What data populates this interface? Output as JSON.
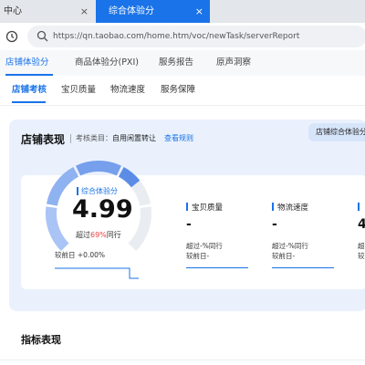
{
  "browser": {
    "tabs": [
      {
        "title": "中心",
        "close": "×"
      },
      {
        "title": "综合体验分",
        "close": "×"
      }
    ],
    "url": "https://qn.taobao.com/home.htm/voc/newTask/serverReport"
  },
  "top_tabs": [
    "店铺体验分",
    "商品体验分(PXI)",
    "服务报告",
    "原声洞察"
  ],
  "sub_tabs": [
    "店铺考核",
    "宝贝质量",
    "物流速度",
    "服务保障"
  ],
  "section": {
    "title": "店铺表现",
    "category_label": "考核类目：",
    "category_value": "自用闲置转让",
    "rule_link": "查看规则",
    "corner_label": "店铺综合体验分"
  },
  "gauge": {
    "label": "综合体验分",
    "value": "4.99",
    "beat_prefix": "超过",
    "beat_percent": "69%",
    "beat_suffix": "同行",
    "fraction": 0.69,
    "prev": "较前日 +0.00%"
  },
  "metrics": [
    {
      "name": "宝贝质量",
      "value": "-",
      "exceed": "超过-%同行",
      "prev": "较前日-"
    },
    {
      "name": "物流速度",
      "value": "-",
      "exceed": "超过-%同行",
      "prev": "较前日-"
    },
    {
      "name": "",
      "value": "4",
      "exceed": "超",
      "prev": "较"
    }
  ],
  "section2_title": "指标表现",
  "colors": {
    "accent": "#1a73e8",
    "highlight": "#e84141",
    "card_bg": "#eaf1fd"
  }
}
